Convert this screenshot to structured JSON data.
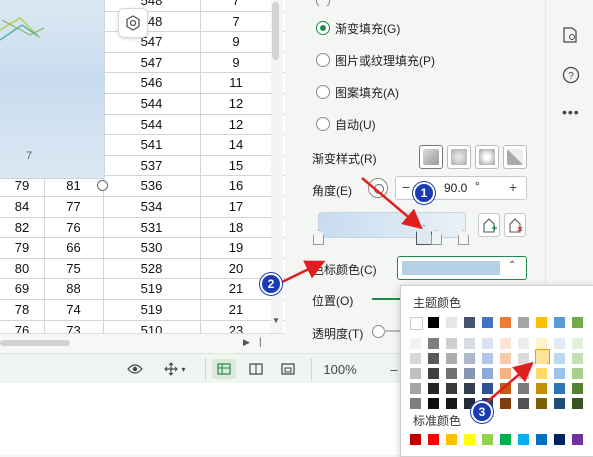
{
  "sheet": {
    "chart_label": "7",
    "rows": [
      [
        "",
        "",
        "548",
        "7"
      ],
      [
        "",
        "",
        "548",
        "7"
      ],
      [
        "",
        "",
        "547",
        "9"
      ],
      [
        "",
        "",
        "547",
        "9"
      ],
      [
        "",
        "",
        "546",
        "11"
      ],
      [
        "",
        "",
        "544",
        "12"
      ],
      [
        "",
        "",
        "544",
        "12"
      ],
      [
        "",
        "",
        "541",
        "14"
      ],
      [
        "",
        "",
        "537",
        "15"
      ],
      [
        "79",
        "81",
        "536",
        "16"
      ],
      [
        "84",
        "77",
        "534",
        "17"
      ],
      [
        "82",
        "76",
        "531",
        "18"
      ],
      [
        "79",
        "66",
        "530",
        "19"
      ],
      [
        "80",
        "75",
        "528",
        "20"
      ],
      [
        "69",
        "88",
        "519",
        "21"
      ],
      [
        "78",
        "74",
        "519",
        "21"
      ],
      [
        "76",
        "73",
        "510",
        "23"
      ]
    ]
  },
  "status": {
    "zoom": "100%",
    "zoom_minus": "–"
  },
  "panel": {
    "fill_options": [
      {
        "label": "渐变填充(G)",
        "selected": true
      },
      {
        "label": "图片或纹理填充(P)",
        "selected": false
      },
      {
        "label": "图案填充(A)",
        "selected": false
      },
      {
        "label": "自动(U)",
        "selected": false
      }
    ],
    "gradient_style_label": "渐变样式(R)",
    "angle_label": "角度(E)",
    "angle_minus": "−",
    "angle_value": "90.0",
    "angle_unit": "°",
    "angle_plus": "+",
    "stop_color_label": "色标颜色(C)",
    "position_label": "位置(O)",
    "transparency_label": "透明度(T)",
    "stop_color": "#b5cfe5"
  },
  "palette": {
    "theme_title": "主题颜色",
    "standard_title": "标准颜色",
    "theme_top": [
      "#ffffff",
      "#000000",
      "#e7e6e6",
      "#44546a",
      "#4472c4",
      "#ed7d31",
      "#a5a5a5",
      "#ffc000",
      "#5b9bd5",
      "#70ad47"
    ],
    "theme_shades": [
      [
        "#f2f2f2",
        "#7f7f7f",
        "#d0cece",
        "#d6dce4",
        "#d9e2f3",
        "#fbe4d5",
        "#ededed",
        "#fff2cc",
        "#deebf6",
        "#e2efd9"
      ],
      [
        "#d8d8d8",
        "#595959",
        "#aeabab",
        "#adb9ca",
        "#b4c6e7",
        "#f7caac",
        "#dbdbdb",
        "#fee599",
        "#bdd7ee",
        "#c5e0b3"
      ],
      [
        "#bfbfbf",
        "#3f3f3f",
        "#757070",
        "#8496b0",
        "#8eaadb",
        "#f4b183",
        "#c9c9c9",
        "#ffd965",
        "#9dc3e6",
        "#a8d08d"
      ],
      [
        "#a5a5a5",
        "#262626",
        "#3a3838",
        "#323f4f",
        "#2f5496",
        "#c55a11",
        "#7b7b7b",
        "#bf9000",
        "#2e75b5",
        "#538135"
      ],
      [
        "#7f7f7f",
        "#0c0c0c",
        "#171616",
        "#222a35",
        "#1f3864",
        "#833c0b",
        "#525252",
        "#7f6000",
        "#1e4e79",
        "#375623"
      ]
    ],
    "standard": [
      "#c00000",
      "#ff0000",
      "#ffc000",
      "#ffff00",
      "#92d050",
      "#00b050",
      "#00b0f0",
      "#0070c0",
      "#002060",
      "#7030a0"
    ]
  },
  "callouts": [
    "1",
    "2",
    "3"
  ],
  "icons": {
    "chart_settings": "settings-hex-icon",
    "right_book": "book-location-icon",
    "right_help": "help-circle-icon",
    "right_more": "more-dots-icon"
  }
}
